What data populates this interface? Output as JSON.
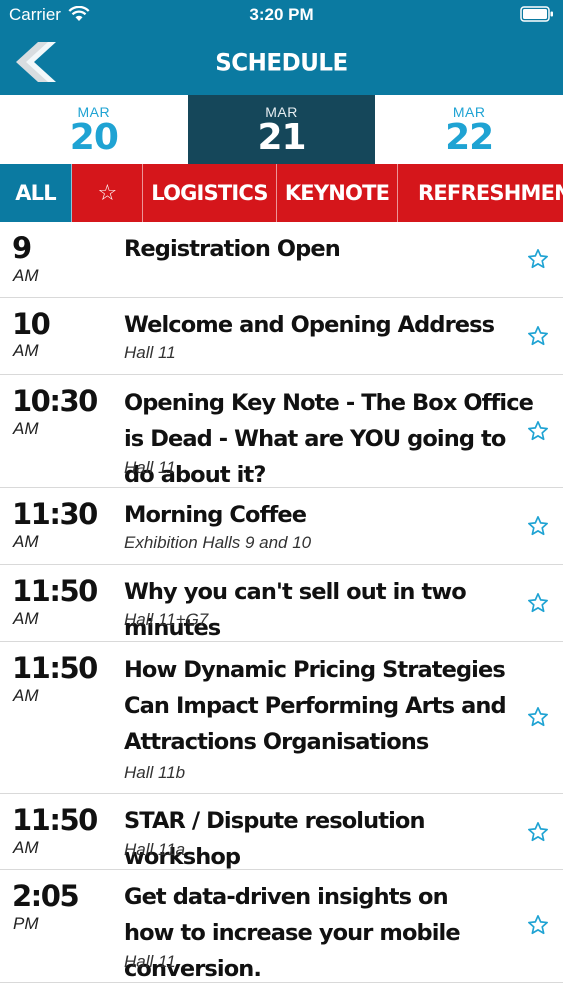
{
  "status_bar": {
    "carrier": "Carrier",
    "time": "3:20 PM"
  },
  "header": {
    "title": "SCHEDULE",
    "back_icon": "chevron-left-icon"
  },
  "dates": [
    {
      "month": "MAR",
      "day": "20",
      "active": false
    },
    {
      "month": "MAR",
      "day": "21",
      "active": true
    },
    {
      "month": "MAR",
      "day": "22",
      "active": false
    }
  ],
  "filters": [
    {
      "label": "ALL",
      "active": true
    },
    {
      "label": "☆",
      "icon": "star-icon",
      "active": false
    },
    {
      "label": "LOGISTICS",
      "active": false
    },
    {
      "label": "KEYNOTE",
      "active": false
    },
    {
      "label": "REFRESHMENTS &",
      "active": false
    }
  ],
  "sessions": [
    {
      "time": "9",
      "ampm": "AM",
      "title": "Registration Open",
      "location": ""
    },
    {
      "time": "10",
      "ampm": "AM",
      "title": "Welcome and Opening Address",
      "location": "Hall 11"
    },
    {
      "time": "10:30",
      "ampm": "AM",
      "title": "Opening Key Note - The Box Office is Dead - What are YOU going to do about it?",
      "location": "Hall 11"
    },
    {
      "time": "11:30",
      "ampm": "AM",
      "title": "Morning Coffee",
      "location": "Exhibition Halls 9 and 10"
    },
    {
      "time": "11:50",
      "ampm": "AM",
      "title": "Why you can't sell out in two minutes",
      "location": "Hall 11+G7"
    },
    {
      "time": "11:50",
      "ampm": "AM",
      "title": "How Dynamic Pricing Strategies Can Impact Performing Arts and Attractions Organisations",
      "location": "Hall 11b"
    },
    {
      "time": "11:50",
      "ampm": "AM",
      "title": "STAR / Dispute resolution workshop",
      "location": "Hall 11a"
    },
    {
      "time": "2:05",
      "ampm": "PM",
      "title": "Get data-driven insights on how to increase your mobile conversion.",
      "location": "Hall 11"
    }
  ],
  "colors": {
    "header": "#0b7aa1",
    "active_date": "#15475a",
    "filter_bar": "#d5161b",
    "accent": "#1fa3d3"
  }
}
